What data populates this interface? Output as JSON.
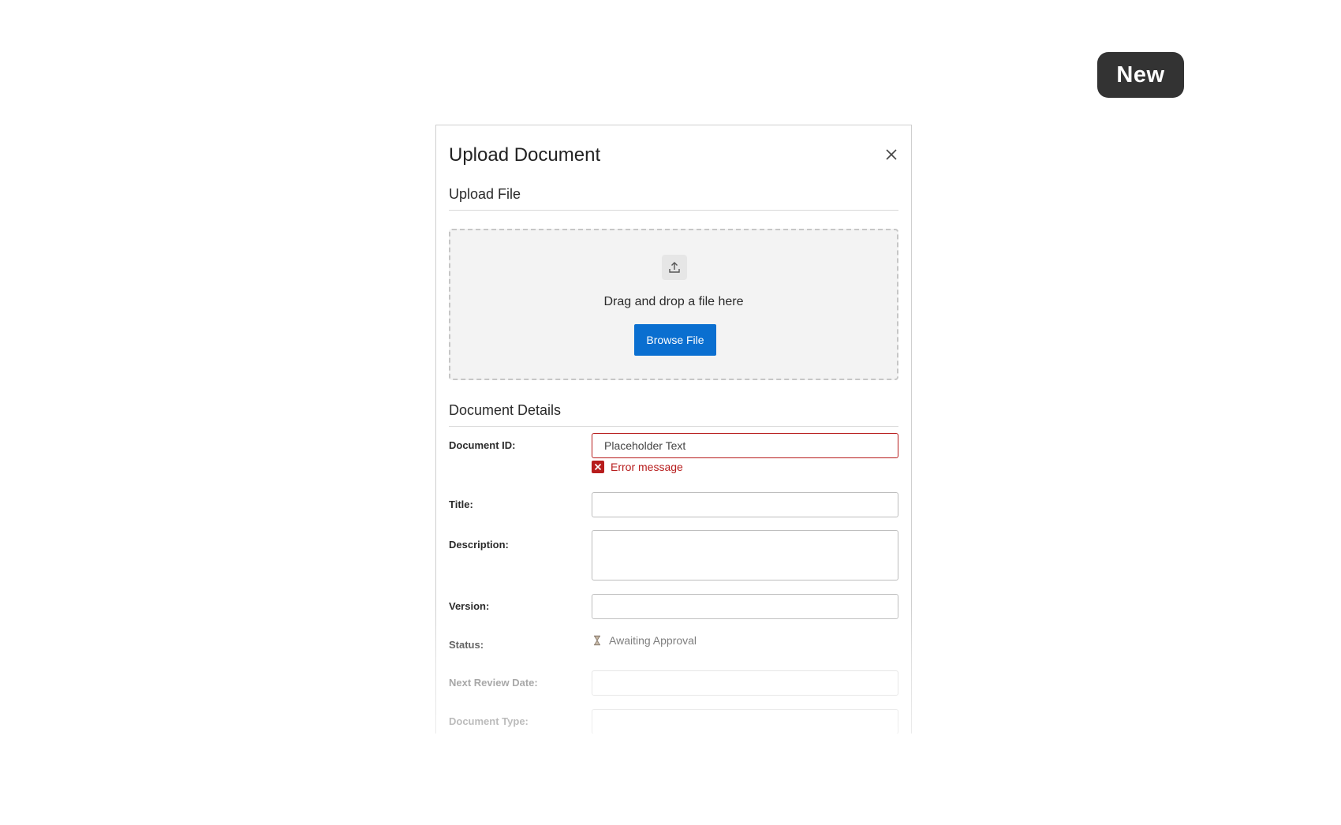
{
  "badge": {
    "label": "New"
  },
  "dialog": {
    "title": "Upload Document",
    "close_icon": "close-icon"
  },
  "upload": {
    "section_title": "Upload File",
    "icon": "upload-icon",
    "drop_text": "Drag and drop a file here",
    "browse_label": "Browse File"
  },
  "details": {
    "section_title": "Document Details",
    "document_id": {
      "label": "Document ID:",
      "placeholder": "Placeholder Text",
      "value": "",
      "error": "Error message"
    },
    "title": {
      "label": "Title:",
      "value": ""
    },
    "description": {
      "label": "Description:",
      "value": ""
    },
    "version": {
      "label": "Version:",
      "value": ""
    },
    "status": {
      "label": "Status:",
      "value": "Awaiting Approval",
      "icon": "hourglass-icon"
    },
    "next_review_date": {
      "label": "Next Review Date:",
      "value": ""
    },
    "document_type": {
      "label": "Document Type:",
      "value": ""
    }
  },
  "colors": {
    "primary": "#0a6fd0",
    "error": "#b71c1c",
    "badge_bg": "#333333"
  }
}
